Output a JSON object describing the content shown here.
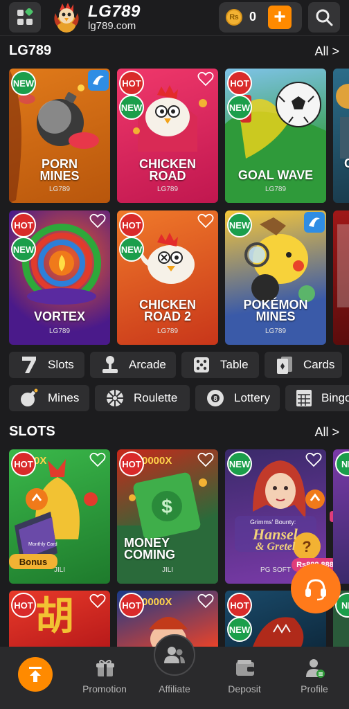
{
  "header": {
    "brand_name": "LG789",
    "brand_url": "lg789.com",
    "balance": "0",
    "coin_symbol": "₨",
    "add_label": "+"
  },
  "sections": {
    "lg789": {
      "title": "LG789",
      "all_label": "All >"
    },
    "slots": {
      "title": "SLOTS",
      "all_label": "All >"
    }
  },
  "lg789_games": [
    {
      "title_line1": "PORN",
      "title_line2": "MINES",
      "provider": "LG789",
      "badges": [
        "NEW"
      ]
    },
    {
      "title_line1": "CHICKEN",
      "title_line2": "ROAD",
      "provider": "LG789",
      "badges": [
        "HOT",
        "NEW"
      ]
    },
    {
      "title_line1": "GOAL WAVE",
      "title_line2": "",
      "provider": "LG789",
      "badges": [
        "HOT",
        "NEW"
      ]
    },
    {
      "title_line1": "VORTEX",
      "title_line2": "",
      "provider": "LG789",
      "badges": [
        "HOT",
        "NEW"
      ]
    },
    {
      "title_line1": "CHICKEN",
      "title_line2": "ROAD 2",
      "provider": "LG789",
      "badges": [
        "HOT",
        "NEW"
      ]
    },
    {
      "title_line1": "POKÉMON",
      "title_line2": "MINES",
      "provider": "LG789",
      "badges": [
        "NEW"
      ]
    }
  ],
  "categories": [
    {
      "label": "Slots",
      "icon": "seven-icon"
    },
    {
      "label": "Arcade",
      "icon": "joystick-icon"
    },
    {
      "label": "Table",
      "icon": "dice-icon"
    },
    {
      "label": "Cards",
      "icon": "cards-icon"
    },
    {
      "label": "Mines",
      "icon": "bomb-icon"
    },
    {
      "label": "Roulette",
      "icon": "roulette-icon"
    },
    {
      "label": "Lottery",
      "icon": "lottery-ball-icon"
    },
    {
      "label": "Bingo",
      "icon": "bingo-card-icon"
    }
  ],
  "slot_games": [
    {
      "title_line1": "",
      "title_line2": "",
      "provider": "JILI",
      "badges": [
        "HOT"
      ],
      "overlay": "0X",
      "bonus_label": "Bonus",
      "card_label": "Monthly Card"
    },
    {
      "title_line1": "MONEY",
      "title_line2": "COMING",
      "provider": "JILI",
      "badges": [
        "HOT"
      ],
      "overlay": "0000X"
    },
    {
      "title_line1": "",
      "title_line2": "",
      "provider": "PG SOFT",
      "badges": [
        "NEW"
      ],
      "logo_small": "Grimms' Bounty:",
      "logo_big1": "Hansel",
      "logo_big2": "& Gretel",
      "price": "Rs888,888"
    },
    {
      "title_line1": "",
      "title_line2": "",
      "provider": "",
      "badges": [
        "HOT"
      ],
      "glyph": "胡"
    },
    {
      "title_line1": "",
      "title_line2": "",
      "provider": "",
      "badges": [
        "HOT"
      ],
      "overlay": "0000X"
    },
    {
      "title_line1": "",
      "title_line2": "",
      "provider": "",
      "badges": [
        "HOT",
        "NEW"
      ]
    }
  ],
  "bottom_nav": [
    {
      "label": "",
      "icon": "arrow-up-icon"
    },
    {
      "label": "Promotion",
      "icon": "gift-icon"
    },
    {
      "label": "Affiliate",
      "icon": "users-icon"
    },
    {
      "label": "Deposit",
      "icon": "wallet-icon"
    },
    {
      "label": "Profile",
      "icon": "profile-icon"
    }
  ],
  "colors": {
    "accent": "#ff8a00",
    "background": "#1c1c1e",
    "new_badge": "#1b9e4b",
    "hot_badge": "#d92a2a"
  }
}
